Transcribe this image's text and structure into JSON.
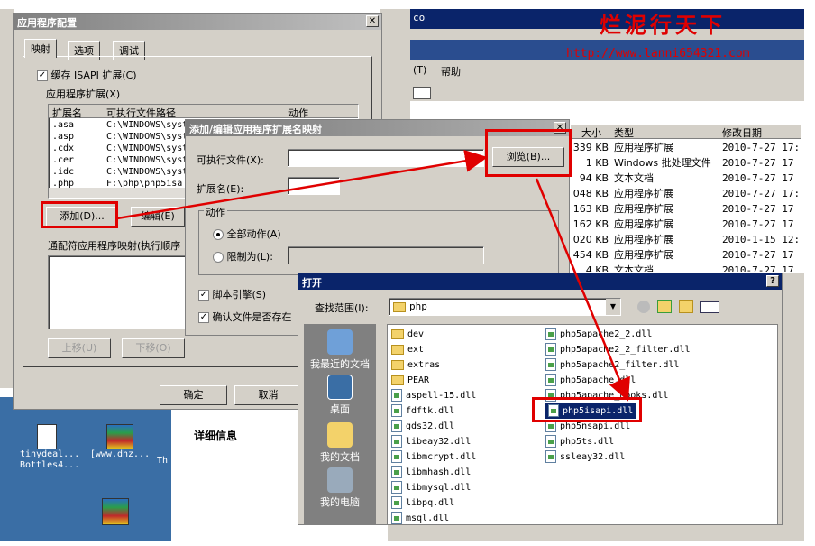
{
  "watermark": {
    "title": "烂泥行天下",
    "url": "http://www.lanni654321.com"
  },
  "config": {
    "title": "应用程序配置",
    "tabs": [
      "映射",
      "选项",
      "调试"
    ],
    "cache_label": "缓存 ISAPI 扩展(C)",
    "ext_group": "应用程序扩展(X)",
    "cols": [
      "扩展名",
      "可执行文件路径",
      "动作"
    ],
    "rows": [
      {
        "ext": ".asa",
        "path": "C:\\WINDOWS\\syst"
      },
      {
        "ext": ".asp",
        "path": "C:\\WINDOWS\\syst"
      },
      {
        "ext": ".cdx",
        "path": "C:\\WINDOWS\\syst"
      },
      {
        "ext": ".cer",
        "path": "C:\\WINDOWS\\syst"
      },
      {
        "ext": ".idc",
        "path": "C:\\WINDOWS\\syst"
      },
      {
        "ext": ".php",
        "path": "F:\\php\\php5isa"
      }
    ],
    "add": "添加(D)...",
    "edit": "编辑(E)",
    "wildcard": "通配符应用程序映射(执行顺序",
    "up": "上移(U)",
    "down": "下移(O)",
    "ok": "确定",
    "cancel": "取消"
  },
  "dialog": {
    "title": "添加/编辑应用程序扩展名映射",
    "exe_label": "可执行文件(X):",
    "browse": "浏览(B)...",
    "ext_label": "扩展名(E):",
    "verbs": "动作",
    "all": "全部动作(A)",
    "limit": "限制为(L):",
    "script": "脚本引擎(S)",
    "verify": "确认文件是否存在"
  },
  "explorer": {
    "menu_a": "(T)",
    "menu_b": "帮助",
    "cols": [
      "大小",
      "类型",
      "修改日期"
    ],
    "rows": [
      {
        "size": "339 KB",
        "type": "应用程序扩展",
        "date": "2010-7-27 17:"
      },
      {
        "size": "1 KB",
        "type": "Windows 批处理文件",
        "date": "2010-7-27 17"
      },
      {
        "size": "94 KB",
        "type": "文本文档",
        "date": "2010-7-27 17"
      },
      {
        "size": "048 KB",
        "type": "应用程序扩展",
        "date": "2010-7-27 17:"
      },
      {
        "size": "163 KB",
        "type": "应用程序扩展",
        "date": "2010-7-27 17"
      },
      {
        "size": "162 KB",
        "type": "应用程序扩展",
        "date": "2010-7-27 17"
      },
      {
        "size": "020 KB",
        "type": "应用程序扩展",
        "date": "2010-1-15 12:"
      },
      {
        "size": "454 KB",
        "type": "应用程序扩展",
        "date": "2010-7-27 17"
      },
      {
        "size": "4 KB",
        "type": "文本文档",
        "date": "2010-7-27 17"
      }
    ],
    "details": "详细信息",
    "top_frag": "co"
  },
  "desktop": {
    "items": [
      {
        "label": "tinydeal...\nBottles4..."
      },
      {
        "label": "[www.dhz..."
      },
      {
        "label": "Th"
      }
    ]
  },
  "open": {
    "title": "打开",
    "help": "?",
    "lookin_label": "查找范围(I):",
    "lookin_value": "php",
    "places": [
      "我最近的文档",
      "桌面",
      "我的文档",
      "我的电脑"
    ],
    "col1": [
      {
        "name": "dev",
        "t": "f"
      },
      {
        "name": "ext",
        "t": "f"
      },
      {
        "name": "extras",
        "t": "f"
      },
      {
        "name": "PEAR",
        "t": "f"
      },
      {
        "name": "aspell-15.dll",
        "t": "d"
      },
      {
        "name": "fdftk.dll",
        "t": "d"
      },
      {
        "name": "gds32.dll",
        "t": "d"
      },
      {
        "name": "libeay32.dll",
        "t": "d"
      },
      {
        "name": "libmcrypt.dll",
        "t": "d"
      },
      {
        "name": "libmhash.dll",
        "t": "d"
      },
      {
        "name": "libmysql.dll",
        "t": "d"
      },
      {
        "name": "libpq.dll",
        "t": "d"
      },
      {
        "name": "msql.dll",
        "t": "d"
      }
    ],
    "col2": [
      {
        "name": "php5apache2_2.dll"
      },
      {
        "name": "php5apache2_2_filter.dll"
      },
      {
        "name": "php5apache2_filter.dll"
      },
      {
        "name": "php5apache.dll"
      },
      {
        "name": "php5apache_hooks.dll"
      },
      {
        "name": "php5isapi.dll"
      },
      {
        "name": "php5nsapi.dll"
      },
      {
        "name": "php5ts.dll"
      },
      {
        "name": "ssleay32.dll"
      }
    ]
  }
}
